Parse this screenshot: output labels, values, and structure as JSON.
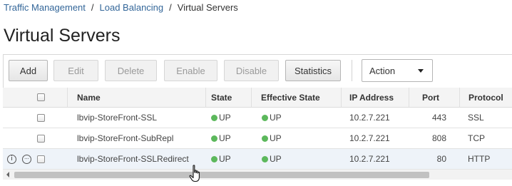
{
  "breadcrumb": {
    "items": [
      "Traffic Management",
      "Load Balancing"
    ],
    "separator": "/",
    "current": "Virtual Servers"
  },
  "page": {
    "title": "Virtual Servers"
  },
  "toolbar": {
    "add": "Add",
    "edit": "Edit",
    "delete": "Delete",
    "enable": "Enable",
    "disable": "Disable",
    "statistics": "Statistics",
    "action": "Action"
  },
  "table": {
    "columns": {
      "name": "Name",
      "state": "State",
      "effective_state": "Effective State",
      "ip_address": "IP Address",
      "port": "Port",
      "protocol": "Protocol"
    },
    "rows": [
      {
        "name": "lbvip-StoreFront-SSL",
        "state": "UP",
        "effective_state": "UP",
        "ip_address": "10.2.7.221",
        "port": "443",
        "protocol": "SSL"
      },
      {
        "name": "lbvip-StoreFront-SubRepl",
        "state": "UP",
        "effective_state": "UP",
        "ip_address": "10.2.7.221",
        "port": "808",
        "protocol": "TCP"
      },
      {
        "name": "lbvip-StoreFront-SSLRedirect",
        "state": "UP",
        "effective_state": "UP",
        "ip_address": "10.2.7.221",
        "port": "80",
        "protocol": "HTTP"
      }
    ],
    "status_color": "#5cb85c",
    "row_icons": {
      "info": "i",
      "more": "···"
    }
  },
  "colors": {
    "link": "#336699",
    "up": "#5cb85c",
    "row_hover": "#eef3f9"
  }
}
